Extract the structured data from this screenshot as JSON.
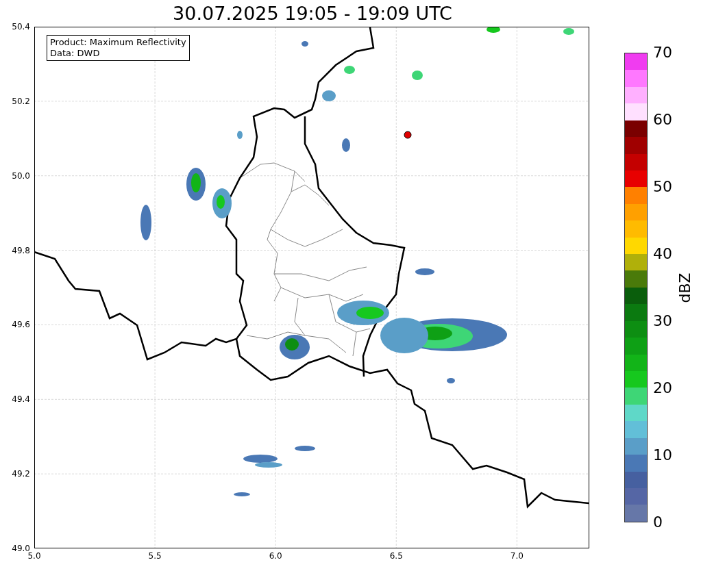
{
  "title": "30.07.2025 19:05 - 19:09 UTC",
  "legend": {
    "lines": [
      "Product: Maximum Reflectivity",
      "Data: DWD"
    ]
  },
  "map": {
    "x_ticks": [
      "5.0",
      "5.5",
      "6.0",
      "6.5",
      "7.0"
    ],
    "y_ticks": [
      "50.4",
      "50.2",
      "50.0",
      "49.8",
      "49.6",
      "49.4",
      "49.2",
      "49.0"
    ]
  },
  "colorbar": {
    "label": "dBZ",
    "ticks": [
      "70",
      "60",
      "50",
      "40",
      "30",
      "20",
      "10",
      "0"
    ],
    "bins": [
      {
        "color": "#6677a8"
      },
      {
        "color": "#5566a5"
      },
      {
        "color": "#4660a0"
      },
      {
        "color": "#4a78b5"
      },
      {
        "color": "#5a9ec8"
      },
      {
        "color": "#62bfd8"
      },
      {
        "color": "#5fd8c8"
      },
      {
        "color": "#3ed676"
      },
      {
        "color": "#16c81e"
      },
      {
        "color": "#12b418"
      },
      {
        "color": "#0ea015"
      },
      {
        "color": "#0d8e12"
      },
      {
        "color": "#0b7a10"
      },
      {
        "color": "#0a5e0c"
      },
      {
        "color": "#4a7a0a"
      },
      {
        "color": "#b0b00a"
      },
      {
        "color": "#ffd800"
      },
      {
        "color": "#ffbb00"
      },
      {
        "color": "#ffa000"
      },
      {
        "color": "#ff8000"
      },
      {
        "color": "#e80000"
      },
      {
        "color": "#c40000"
      },
      {
        "color": "#a00000"
      },
      {
        "color": "#7a0000"
      },
      {
        "color": "#ffe0ff"
      },
      {
        "color": "#ffb0ff"
      },
      {
        "color": "#ff78ff"
      },
      {
        "color": "#f03cf0"
      }
    ]
  }
}
